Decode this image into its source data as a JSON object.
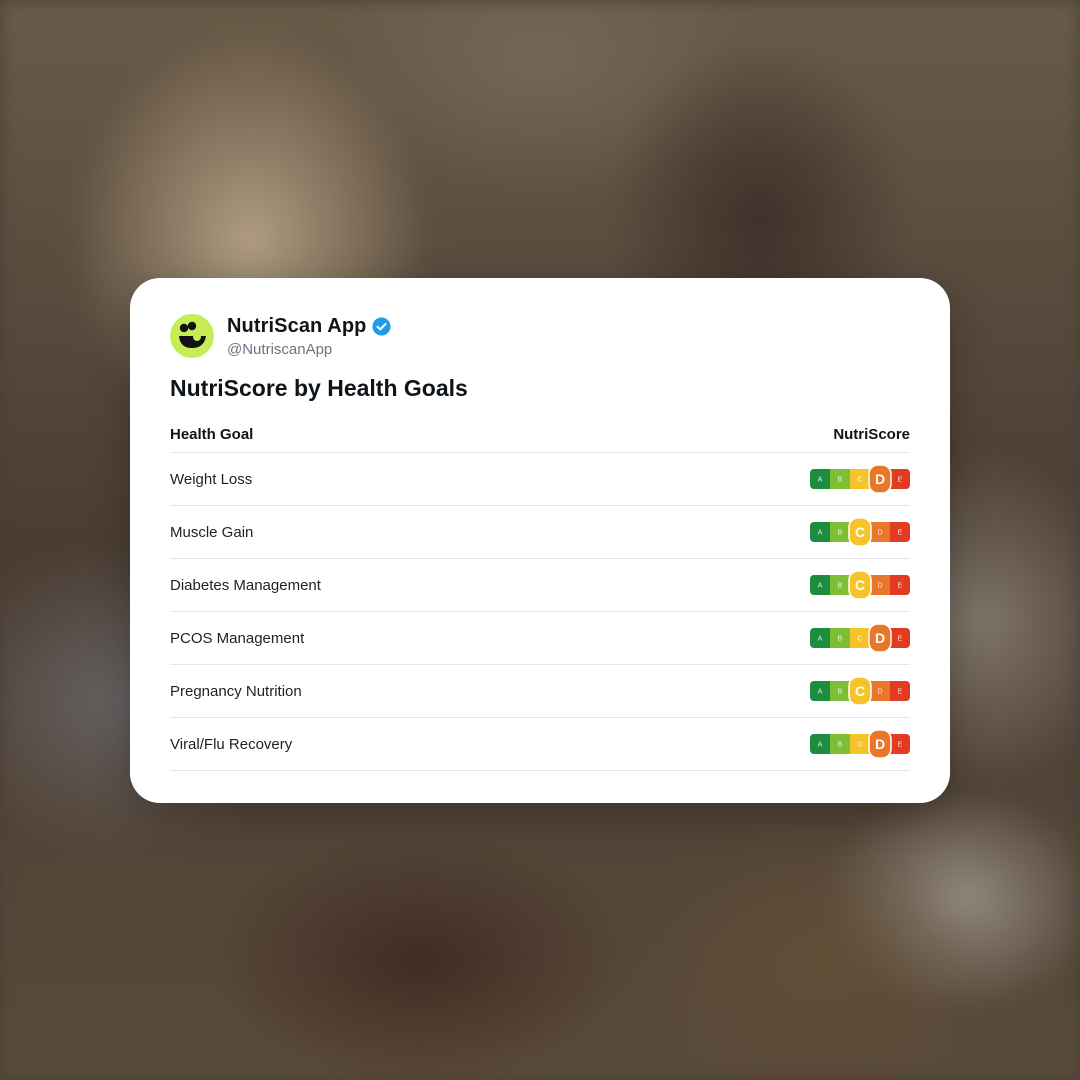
{
  "account": {
    "display_name": "NutriScan App",
    "handle": "@NutriscanApp",
    "verified_icon": "verified-badge-icon",
    "avatar_icon": "nutriscan-logo-icon"
  },
  "post": {
    "title": "NutriScore by Health Goals"
  },
  "table": {
    "headers": [
      "Health Goal",
      "NutriScore"
    ],
    "rows": [
      {
        "goal": "Weight Loss",
        "score": "D"
      },
      {
        "goal": "Muscle Gain",
        "score": "C"
      },
      {
        "goal": "Diabetes Management",
        "score": "C"
      },
      {
        "goal": "PCOS Management",
        "score": "D"
      },
      {
        "goal": "Pregnancy Nutrition",
        "score": "C"
      },
      {
        "goal": "Viral/Flu Recovery",
        "score": "D"
      }
    ]
  },
  "nutriscore": {
    "grades": [
      "A",
      "B",
      "C",
      "D",
      "E"
    ],
    "colors": {
      "A": "#1e8c3e",
      "B": "#7cbf34",
      "C": "#f6c42a",
      "D": "#e8772a",
      "E": "#e33b22"
    }
  },
  "colors": {
    "avatar_bg": "#c6ec58",
    "verified": "#1d9bf0",
    "divider": "#e3e5e8"
  }
}
